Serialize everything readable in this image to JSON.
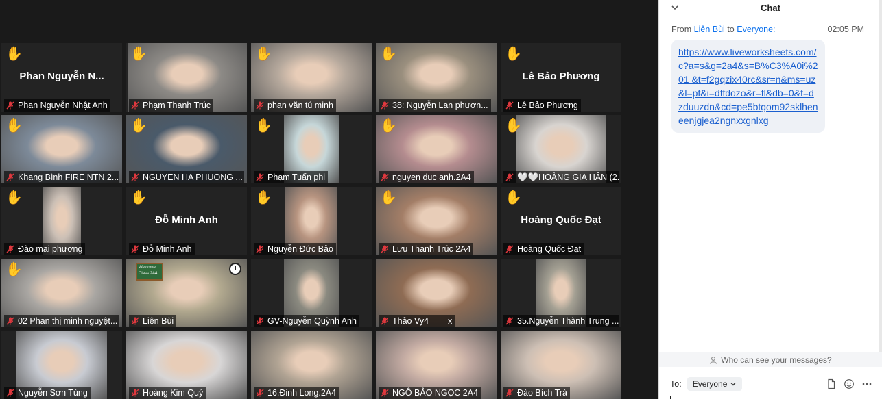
{
  "gallery": {
    "tiles": [
      {
        "name": "Phan Nguyễn Nhật Anh",
        "big": "Phan  Nguyễn  N...",
        "hand": "✋",
        "video": false
      },
      {
        "name": "Phạm Thanh Trúc",
        "big": "",
        "hand": "✋",
        "video": true
      },
      {
        "name": "phan văn tú minh",
        "big": "",
        "hand": "✋",
        "video": true
      },
      {
        "name": "38:  Nguyễn Lan phươn...",
        "big": "",
        "hand": "✋",
        "video": true
      },
      {
        "name": "Lê Bảo Phương",
        "big": "Lê Bảo Phương",
        "hand": "✋",
        "video": false
      },
      {
        "name": "Khang Bình FIRE NTN 2...",
        "big": "",
        "hand": "✋",
        "video": true
      },
      {
        "name": "NGUYEN HA  PHUONG ...",
        "big": "",
        "hand": "✋",
        "video": true
      },
      {
        "name": "Phạm Tuấn phi",
        "big": "",
        "hand": "✋",
        "video": true
      },
      {
        "name": "nguyen duc anh.2A4",
        "big": "",
        "hand": "✋",
        "video": true
      },
      {
        "name": "🤍🤍HOÀNG GIA HÂN (2...",
        "big": "",
        "hand": "✋",
        "video": true
      },
      {
        "name": "Đào mai phương",
        "big": "",
        "hand": "✋",
        "video": true
      },
      {
        "name": "Đỗ Minh Anh",
        "big": "Đỗ Minh Anh",
        "hand": "✋",
        "video": false
      },
      {
        "name": "Nguyễn Đức  Bảo",
        "big": "",
        "hand": "✋",
        "video": true
      },
      {
        "name": "Lưu Thanh Trúc 2A4",
        "big": "",
        "hand": "✋",
        "video": true
      },
      {
        "name": "Hoàng Quốc Đạt",
        "big": "Hoàng Quốc Đạt",
        "hand": "✋",
        "video": false
      },
      {
        "name": "02 Phan thị minh nguyệt...",
        "big": "",
        "hand": "✋",
        "video": true
      },
      {
        "name": "Liên Bùi",
        "big": "",
        "hand": "",
        "video": true
      },
      {
        "name": "GV-Nguyễn Quỳnh Anh",
        "big": "",
        "hand": "",
        "video": true
      },
      {
        "name": "Thảo Vy4",
        "big": "",
        "hand": "",
        "video": true
      },
      {
        "name": "35.Nguyễn Thành Trung ...",
        "big": "",
        "hand": "",
        "video": true
      },
      {
        "name": "Nguyễn Sơn Tùng",
        "big": "",
        "hand": "",
        "video": true
      },
      {
        "name": "Hoàng Kim Quý",
        "big": "",
        "hand": "",
        "video": true
      },
      {
        "name": "16.Đinh Long.2A4",
        "big": "",
        "hand": "",
        "video": true
      },
      {
        "name": "NGÔ BẢO NGỌC 2A4",
        "big": "",
        "hand": "",
        "video": true
      },
      {
        "name": "Đào Bích Trà",
        "big": "",
        "hand": "",
        "video": true
      }
    ],
    "video_colors": [
      "#b9b2ab",
      "#8d8a86",
      "#b5a89c",
      "#9a8f7e",
      "#cfc7c0",
      "#7d8a99",
      "#4a5a6a",
      "#c6d7d9",
      "#b48c8f",
      "#d8d4d0",
      "#cbbfb5",
      "#b9a27b",
      "#b79480",
      "#a37e67",
      "#c9b9a7",
      "#a9a6a2",
      "#b2a98f",
      "#8b8a80",
      "#8f6c54",
      "#a4a093",
      "#c8cbd2",
      "#d8d6d6",
      "#b0a393",
      "#c1a9a1",
      "#cdbfb4"
    ],
    "active_speaker": "Liên Bùi",
    "thao_vy_extra": "x",
    "lien_bui_board": [
      "Welcome",
      "Class 2A4"
    ]
  },
  "chat": {
    "title": "Chat",
    "meta_from": "From",
    "meta_sender": "Liên Bùi",
    "meta_to": "to",
    "meta_recipient": "Everyone:",
    "time": "02:05 PM",
    "message": "https://www.liveworksheets.com/c?a=s&g=2a4&s=B%C3%A0i%201 &t=f2gqzix40rc&sr=n&ms=uz&l=pf&i=dffdozo&r=fl&db=0&f=dzduuzdn&cd=pe5btgom92sklheneenjgjea2ngnxxgnlxg",
    "who_can_see": "Who can see your messages?",
    "to_label": "To:",
    "to_value": "Everyone"
  },
  "colors": {
    "raised_hand": "#f5b942",
    "muted_mic": "#e0383e",
    "active_outline": "#c9e24a",
    "link": "#1a5fcf"
  }
}
